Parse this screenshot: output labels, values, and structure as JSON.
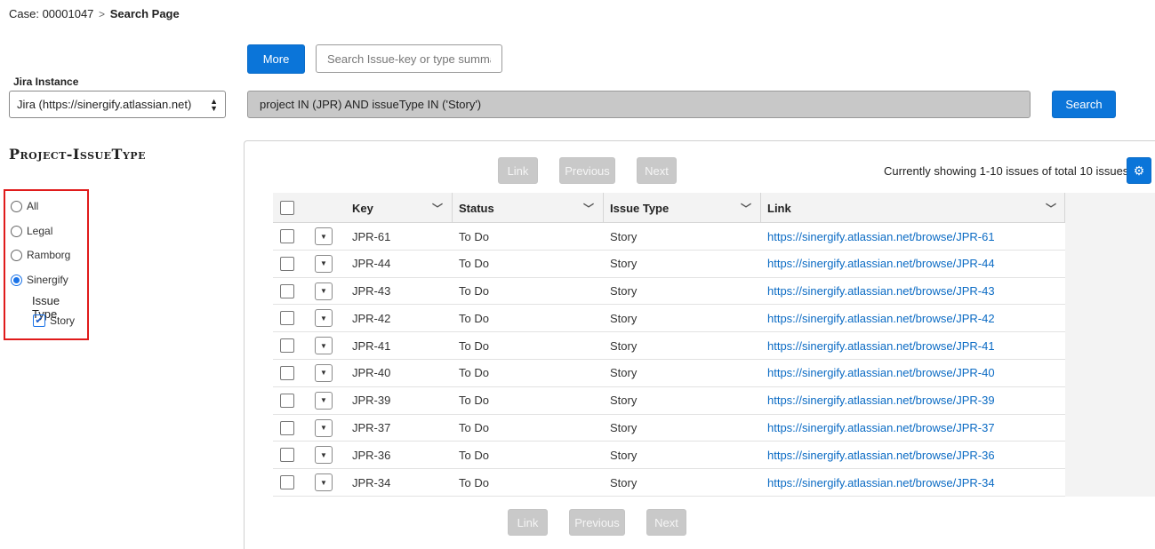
{
  "breadcrumb": {
    "case": "Case: 00001047",
    "separator": ">",
    "current": "Search Page"
  },
  "toolbar": {
    "more_label": "More",
    "search_placeholder": "Search Issue-key or type summa",
    "search_label": "Search"
  },
  "jira": {
    "label": "Jira Instance",
    "selected": "Jira (https://sinergify.atlassian.net)"
  },
  "jql": "project IN (JPR) AND issueType IN ('Story')",
  "filters": {
    "heading": "Project-IssueType",
    "options": [
      {
        "label": "All",
        "selected": false
      },
      {
        "label": "Legal",
        "selected": false
      },
      {
        "label": "Ramborg",
        "selected": false
      },
      {
        "label": "Sinergify",
        "selected": true
      }
    ],
    "issue_type_label": "Issue Type",
    "issue_types": [
      {
        "label": "Story",
        "checked": true
      }
    ]
  },
  "pagination": {
    "link": "Link",
    "previous": "Previous",
    "next": "Next",
    "showing": "Currently showing 1-10 issues of total 10 issues"
  },
  "table": {
    "columns": [
      "Key",
      "Status",
      "Issue Type",
      "Link"
    ],
    "rows": [
      {
        "key": "JPR-61",
        "status": "To Do",
        "type": "Story",
        "link": "https://sinergify.atlassian.net/browse/JPR-61"
      },
      {
        "key": "JPR-44",
        "status": "To Do",
        "type": "Story",
        "link": "https://sinergify.atlassian.net/browse/JPR-44"
      },
      {
        "key": "JPR-43",
        "status": "To Do",
        "type": "Story",
        "link": "https://sinergify.atlassian.net/browse/JPR-43"
      },
      {
        "key": "JPR-42",
        "status": "To Do",
        "type": "Story",
        "link": "https://sinergify.atlassian.net/browse/JPR-42"
      },
      {
        "key": "JPR-41",
        "status": "To Do",
        "type": "Story",
        "link": "https://sinergify.atlassian.net/browse/JPR-41"
      },
      {
        "key": "JPR-40",
        "status": "To Do",
        "type": "Story",
        "link": "https://sinergify.atlassian.net/browse/JPR-40"
      },
      {
        "key": "JPR-39",
        "status": "To Do",
        "type": "Story",
        "link": "https://sinergify.atlassian.net/browse/JPR-39"
      },
      {
        "key": "JPR-37",
        "status": "To Do",
        "type": "Story",
        "link": "https://sinergify.atlassian.net/browse/JPR-37"
      },
      {
        "key": "JPR-36",
        "status": "To Do",
        "type": "Story",
        "link": "https://sinergify.atlassian.net/browse/JPR-36"
      },
      {
        "key": "JPR-34",
        "status": "To Do",
        "type": "Story",
        "link": "https://sinergify.atlassian.net/browse/JPR-34"
      }
    ]
  },
  "colors": {
    "primary": "#0b75d9",
    "link": "#0b6bc4",
    "highlight_border": "#e01b1b",
    "disabled": "#c9c9c9"
  },
  "icons": {
    "settings": "gear-icon",
    "column_menu": "chevron-down-icon",
    "row_menu": "caret-down-icon",
    "select_arrows": "updown-arrows-icon"
  }
}
